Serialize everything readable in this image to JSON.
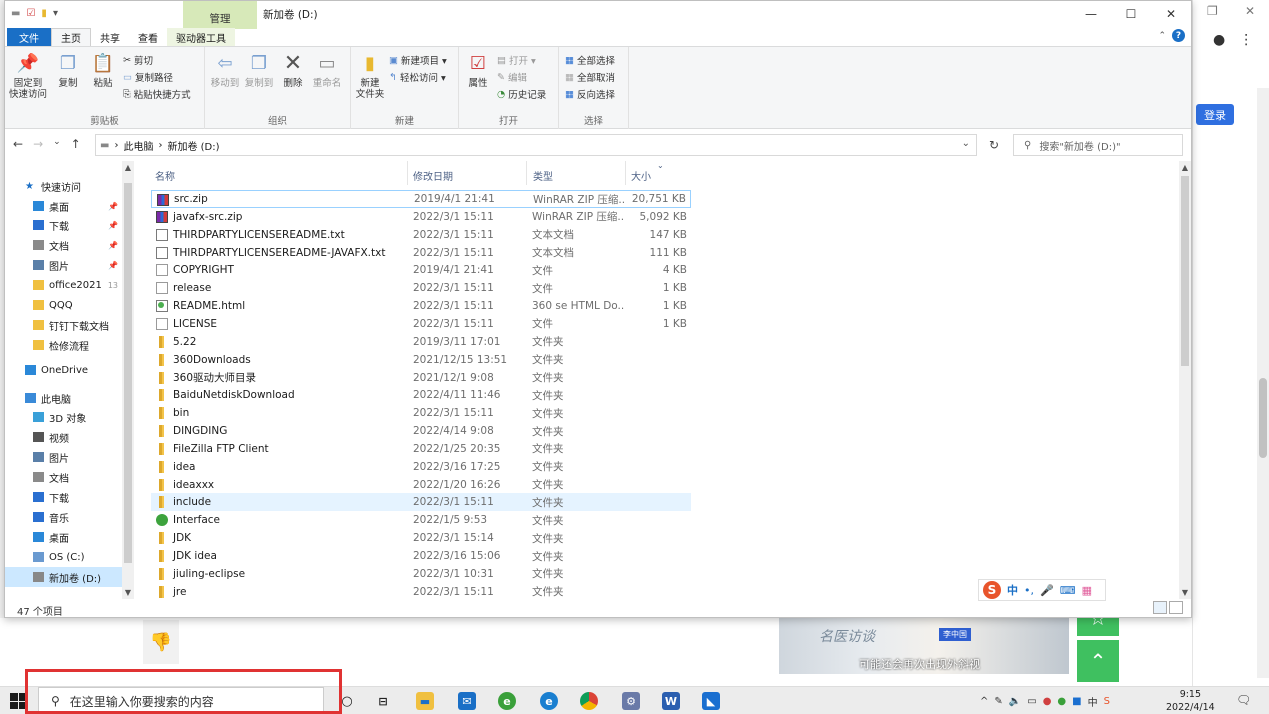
{
  "browser": {
    "login_label": "登录"
  },
  "video": {
    "logo_text": "名医访谈",
    "name_tag": "李中国",
    "caption": "可能还会再次出现外斜视"
  },
  "window": {
    "context_tab": "管理",
    "title": "新加卷 (D:)"
  },
  "tabs": [
    "文件",
    "主页",
    "共享",
    "查看",
    "驱动器工具"
  ],
  "ribbon": {
    "clipboard": {
      "label": "剪贴板",
      "pin": "固定到\n快速访问",
      "copy": "复制",
      "paste": "粘贴",
      "cut": "剪切",
      "copy_path": "复制路径",
      "paste_shortcut": "粘贴快捷方式"
    },
    "organize": {
      "label": "组织",
      "move_to": "移动到",
      "copy_to": "复制到",
      "delete": "删除",
      "rename": "重命名"
    },
    "new": {
      "label": "新建",
      "new_folder": "新建\n文件夹",
      "new_item": "新建项目 ▾",
      "easy_access": "轻松访问 ▾"
    },
    "open": {
      "label": "打开",
      "properties": "属性",
      "open": "打开 ▾",
      "edit": "编辑",
      "history": "历史记录"
    },
    "select": {
      "label": "选择",
      "select_all": "全部选择",
      "select_none": "全部取消",
      "invert": "反向选择"
    }
  },
  "address": {
    "crumb1": "此电脑",
    "crumb2": "新加卷 (D:)",
    "search_placeholder": "搜索\"新加卷 (D:)\""
  },
  "nav": [
    {
      "label": "快速访问",
      "icon": "star-icon",
      "color": "#1a6fc6",
      "indent": 0,
      "pin": ""
    },
    {
      "label": "桌面",
      "icon": "desktop-icon",
      "color": "#2a88d8",
      "indent": 1,
      "pin": "📌"
    },
    {
      "label": "下载",
      "icon": "download-icon",
      "color": "#2a6fd0",
      "indent": 1,
      "pin": "📌"
    },
    {
      "label": "文档",
      "icon": "document-icon",
      "color": "#8a8a8a",
      "indent": 1,
      "pin": "📌"
    },
    {
      "label": "图片",
      "icon": "picture-icon",
      "color": "#5a7fa8",
      "indent": 1,
      "pin": "📌"
    },
    {
      "label": "office2021",
      "icon": "folder-icon",
      "color": "#f0c040",
      "indent": 1,
      "pin": "13"
    },
    {
      "label": "QQQ",
      "icon": "folder-icon",
      "color": "#f0c040",
      "indent": 1,
      "pin": ""
    },
    {
      "label": "钉钉下载文档",
      "icon": "folder-icon",
      "color": "#f0c040",
      "indent": 1,
      "pin": ""
    },
    {
      "label": "检修流程",
      "icon": "folder-icon",
      "color": "#f0c040",
      "indent": 1,
      "pin": ""
    },
    {
      "label": "OneDrive",
      "icon": "cloud-icon",
      "color": "#2a88d8",
      "indent": 0,
      "pin": ""
    },
    {
      "label": "此电脑",
      "icon": "computer-icon",
      "color": "#3a8ad8",
      "indent": 0,
      "pin": ""
    },
    {
      "label": "3D 对象",
      "icon": "cube-icon",
      "color": "#3aa0d8",
      "indent": 1,
      "pin": ""
    },
    {
      "label": "视频",
      "icon": "video-icon",
      "color": "#555",
      "indent": 1,
      "pin": ""
    },
    {
      "label": "图片",
      "icon": "picture-icon",
      "color": "#5a7fa8",
      "indent": 1,
      "pin": ""
    },
    {
      "label": "文档",
      "icon": "document-icon",
      "color": "#8a8a8a",
      "indent": 1,
      "pin": ""
    },
    {
      "label": "下载",
      "icon": "download-icon",
      "color": "#2a6fd0",
      "indent": 1,
      "pin": ""
    },
    {
      "label": "音乐",
      "icon": "music-icon",
      "color": "#2a6fd0",
      "indent": 1,
      "pin": ""
    },
    {
      "label": "桌面",
      "icon": "desktop-icon",
      "color": "#2a88d8",
      "indent": 1,
      "pin": ""
    },
    {
      "label": "OS (C:)",
      "icon": "drive-icon",
      "color": "#6a9ad0",
      "indent": 1,
      "pin": ""
    },
    {
      "label": "新加卷 (D:)",
      "icon": "drive-icon",
      "color": "#888",
      "indent": 1,
      "pin": ""
    }
  ],
  "columns": {
    "name": "名称",
    "date": "修改日期",
    "type": "类型",
    "size": "大小"
  },
  "files": [
    {
      "name": "src.zip",
      "date": "2019/4/1 21:41",
      "type": "WinRAR ZIP 压缩...",
      "size": "20,751 KB",
      "kind": "zip"
    },
    {
      "name": "javafx-src.zip",
      "date": "2022/3/1 15:11",
      "type": "WinRAR ZIP 压缩...",
      "size": "5,092 KB",
      "kind": "zip"
    },
    {
      "name": "THIRDPARTYLICENSEREADME.txt",
      "date": "2022/3/1 15:11",
      "type": "文本文档",
      "size": "147 KB",
      "kind": "txt"
    },
    {
      "name": "THIRDPARTYLICENSEREADME-JAVAFX.txt",
      "date": "2022/3/1 15:11",
      "type": "文本文档",
      "size": "111 KB",
      "kind": "txt"
    },
    {
      "name": "COPYRIGHT",
      "date": "2019/4/1 21:41",
      "type": "文件",
      "size": "4 KB",
      "kind": "doc"
    },
    {
      "name": "release",
      "date": "2022/3/1 15:11",
      "type": "文件",
      "size": "1 KB",
      "kind": "doc"
    },
    {
      "name": "README.html",
      "date": "2022/3/1 15:11",
      "type": "360 se HTML Do...",
      "size": "1 KB",
      "kind": "html"
    },
    {
      "name": "LICENSE",
      "date": "2022/3/1 15:11",
      "type": "文件",
      "size": "1 KB",
      "kind": "doc"
    },
    {
      "name": "5.22",
      "date": "2019/3/11 17:01",
      "type": "文件夹",
      "size": "",
      "kind": "folder"
    },
    {
      "name": "360Downloads",
      "date": "2021/12/15 13:51",
      "type": "文件夹",
      "size": "",
      "kind": "folder"
    },
    {
      "name": "360驱动大师目录",
      "date": "2021/12/1 9:08",
      "type": "文件夹",
      "size": "",
      "kind": "folder"
    },
    {
      "name": "BaiduNetdiskDownload",
      "date": "2022/4/11 11:46",
      "type": "文件夹",
      "size": "",
      "kind": "folder"
    },
    {
      "name": "bin",
      "date": "2022/3/1 15:11",
      "type": "文件夹",
      "size": "",
      "kind": "folder"
    },
    {
      "name": "DINGDING",
      "date": "2022/4/14 9:08",
      "type": "文件夹",
      "size": "",
      "kind": "folder"
    },
    {
      "name": "FileZilla FTP Client",
      "date": "2022/1/25 20:35",
      "type": "文件夹",
      "size": "",
      "kind": "folder"
    },
    {
      "name": "idea",
      "date": "2022/3/16 17:25",
      "type": "文件夹",
      "size": "",
      "kind": "folder"
    },
    {
      "name": "ideaxxx",
      "date": "2022/1/20 16:26",
      "type": "文件夹",
      "size": "",
      "kind": "folder"
    },
    {
      "name": "include",
      "date": "2022/3/1 15:11",
      "type": "文件夹",
      "size": "",
      "kind": "folder"
    },
    {
      "name": "Interface",
      "date": "2022/1/5 9:53",
      "type": "文件夹",
      "size": "",
      "kind": "iface"
    },
    {
      "name": "JDK",
      "date": "2022/3/1 15:14",
      "type": "文件夹",
      "size": "",
      "kind": "folder"
    },
    {
      "name": "JDK idea",
      "date": "2022/3/16 15:06",
      "type": "文件夹",
      "size": "",
      "kind": "folder"
    },
    {
      "name": "jiuling-eclipse",
      "date": "2022/3/1 10:31",
      "type": "文件夹",
      "size": "",
      "kind": "folder"
    },
    {
      "name": "jre",
      "date": "2022/3/1 15:11",
      "type": "文件夹",
      "size": "",
      "kind": "folder"
    }
  ],
  "status": {
    "count": "47 个项目"
  },
  "ime": {
    "logo": "S",
    "lang": "中"
  },
  "taskbar": {
    "search_placeholder": "在这里输入你要搜索的内容",
    "time": "9:15",
    "date": "2022/4/14"
  }
}
